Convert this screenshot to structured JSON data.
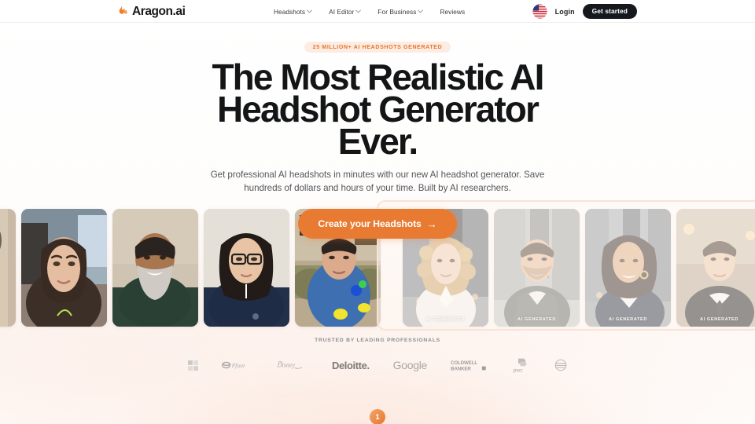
{
  "header": {
    "brand": {
      "name": "Aragon.ai",
      "icon": "flame-icon"
    },
    "nav": [
      {
        "label": "Headshots",
        "has_dropdown": true
      },
      {
        "label": "AI Editor",
        "has_dropdown": true
      },
      {
        "label": "For Business",
        "has_dropdown": true
      },
      {
        "label": "Reviews",
        "has_dropdown": false
      }
    ],
    "locale_icon": "us-flag-icon",
    "login_label": "Login",
    "get_started_label": "Get started"
  },
  "hero": {
    "badge": "25 MILLION+ AI HEADSHOTS GENERATED",
    "headline_line1": "The Most Realistic AI",
    "headline_line2": "Headshot Generator Ever.",
    "subhead": "Get professional AI headshots in minutes with our new AI headshot generator. Save hundreds of dollars and hours of your time. Built by AI researchers.",
    "cta_label": "Create your Headshots",
    "cta_arrow": "→"
  },
  "carousel": {
    "ai_tag": "AI GENERATED",
    "before_cards": [
      {
        "name": "before-photo-0",
        "alt": "person holding phone selfie",
        "partial": true
      },
      {
        "name": "before-photo-1",
        "alt": "woman in car selfie"
      },
      {
        "name": "before-photo-2",
        "alt": "bearded man smiling selfie"
      },
      {
        "name": "before-photo-3",
        "alt": "woman with glasses selfie"
      },
      {
        "name": "before-photo-4",
        "alt": "man in blue shirt living room selfie"
      }
    ],
    "after_cards": [
      {
        "name": "ai-photo-0",
        "alt": "woman with curly hair white blouse city background"
      },
      {
        "name": "ai-photo-1",
        "alt": "man in gray suit smiling"
      },
      {
        "name": "ai-photo-2",
        "alt": "woman in navy blazer city background"
      },
      {
        "name": "ai-photo-3",
        "alt": "young man in black suit and tie"
      },
      {
        "name": "ai-photo-4",
        "alt": "partially visible portrait",
        "partial": true
      }
    ]
  },
  "social_proof": {
    "label": "TRUSTED BY LEADING PROFESSIONALS",
    "logos": [
      {
        "name": "microsoft-logo",
        "label": "Microsoft"
      },
      {
        "name": "pfizer-logo",
        "label": "Pfizer"
      },
      {
        "name": "disney-logo",
        "label": "Disney"
      },
      {
        "name": "deloitte-logo",
        "label": "Deloitte."
      },
      {
        "name": "google-logo",
        "label": "Google"
      },
      {
        "name": "coldwell-banker-logo",
        "label": "COLDWELL BANKER"
      },
      {
        "name": "pwc-logo",
        "label": "pwc"
      },
      {
        "name": "att-logo",
        "label": "AT&T"
      }
    ]
  },
  "pager": {
    "current": "1"
  },
  "colors": {
    "accent": "#e97a32",
    "badge_bg": "#fdece2",
    "badge_text": "#e4762f",
    "dark": "#15181c",
    "frame": "#fae2d6"
  }
}
